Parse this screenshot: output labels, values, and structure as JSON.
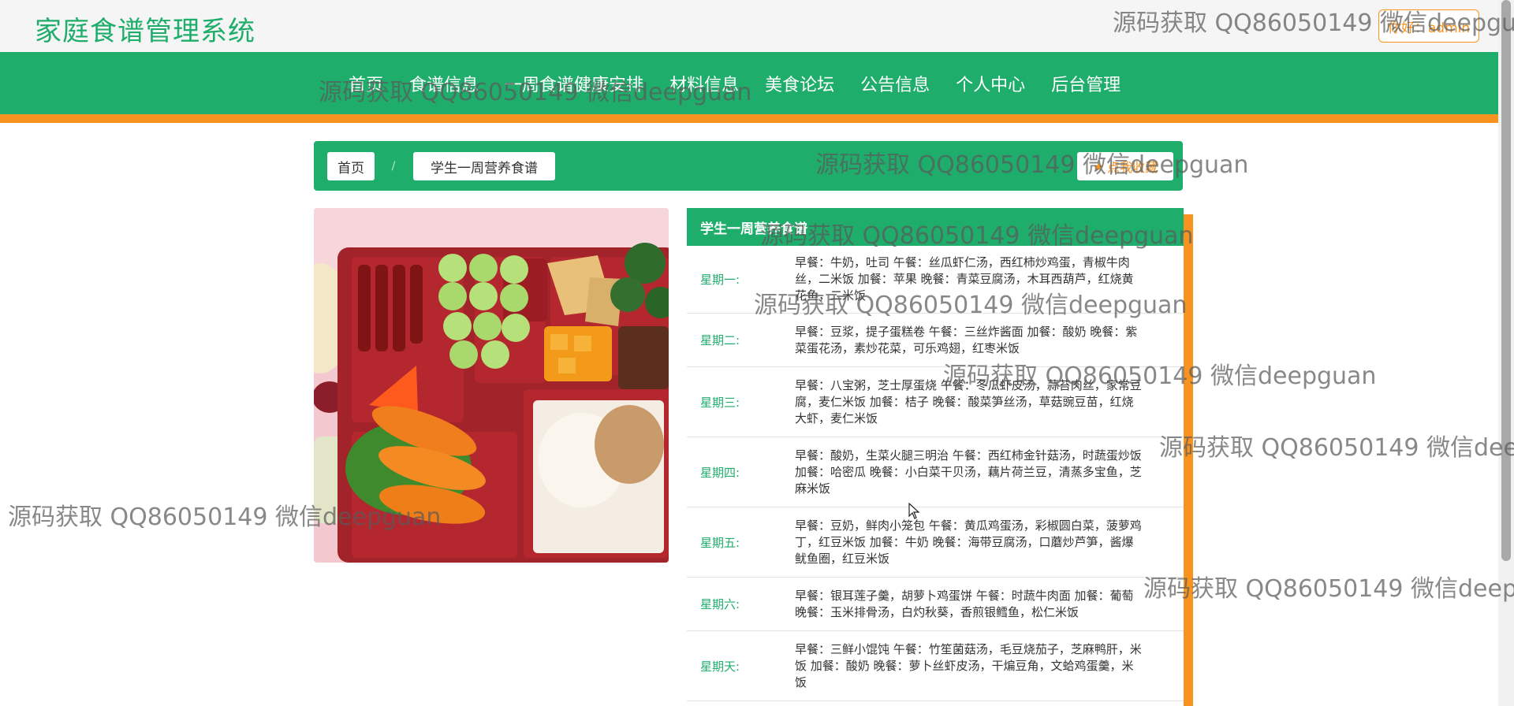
{
  "header": {
    "site_title": "家庭食谱管理系统",
    "user_button": "你好：admin"
  },
  "nav": {
    "items": [
      "首页",
      "食谱信息",
      "一周食谱健康安排",
      "材料信息",
      "美食论坛",
      "公告信息",
      "个人中心",
      "后台管理"
    ]
  },
  "breadcrumb": {
    "home": "首页",
    "separator": "/",
    "current": "学生一周营养食谱",
    "favorite_label": "点我收藏",
    "favorite_icon": "star-icon"
  },
  "menu": {
    "title": "学生一周营养食谱",
    "rows": [
      {
        "day": "星期一:",
        "meal": "早餐：牛奶，吐司 午餐：丝瓜虾仁汤，西红柿炒鸡蛋，青椒牛肉丝，二米饭 加餐：苹果 晚餐：青菜豆腐汤，木耳西葫芦，红烧黄花鱼，二米饭"
      },
      {
        "day": "星期二:",
        "meal": "早餐：豆浆，提子蛋糕卷 午餐：三丝炸酱面 加餐：酸奶 晚餐：紫菜蛋花汤，素炒花菜，可乐鸡翅，红枣米饭"
      },
      {
        "day": "星期三:",
        "meal": "早餐：八宝粥，芝士厚蛋烧 午餐：冬瓜虾皮汤，蒜苔肉丝，家常豆腐，麦仁米饭 加餐：桔子 晚餐：酸菜笋丝汤，草菇豌豆苗，红烧大虾，麦仁米饭"
      },
      {
        "day": "星期四:",
        "meal": "早餐：酸奶，生菜火腿三明治 午餐：西红柿金针菇汤，时蔬蛋炒饭 加餐：哈密瓜 晚餐：小白菜干贝汤，藕片荷兰豆，清蒸多宝鱼，芝麻米饭"
      },
      {
        "day": "星期五:",
        "meal": "早餐：豆奶，鲜肉小笼包 午餐：黄瓜鸡蛋汤，彩椒圆白菜，菠萝鸡丁，红豆米饭 加餐：牛奶 晚餐：海带豆腐汤，口蘑炒芦笋，酱爆鱿鱼圈，红豆米饭"
      },
      {
        "day": "星期六:",
        "meal": "早餐：银耳莲子羹，胡萝卜鸡蛋饼 午餐：时蔬牛肉面 加餐：葡萄 晚餐：玉米排骨汤，白灼秋葵，香煎银鳕鱼，松仁米饭"
      },
      {
        "day": "星期天:",
        "meal": "早餐：三鲜小馄饨 午餐：竹笙菌菇汤，毛豆烧茄子，芝麻鸭肝，米饭 加餐：酸奶 晚餐：萝卜丝虾皮汤，干煸豆角，文蛤鸡蛋羹，米饭"
      }
    ]
  },
  "watermark": {
    "text": "源码获取 QQ86050149 微信deepguan"
  },
  "colors": {
    "brand_green": "#1fad6b",
    "accent_orange": "#f7931e"
  }
}
